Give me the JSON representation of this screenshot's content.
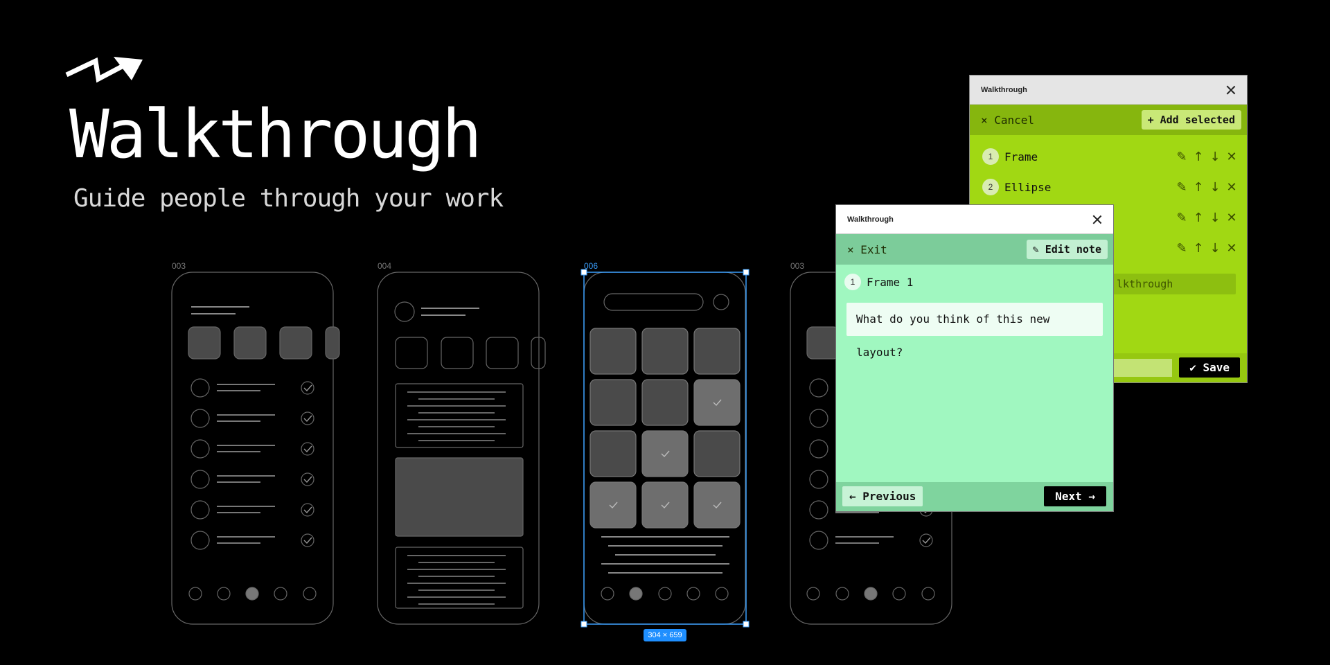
{
  "hero": {
    "title": "Walkthrough",
    "subtitle": "Guide people through your work"
  },
  "frames": [
    {
      "label": "003",
      "selected": false
    },
    {
      "label": "004",
      "selected": false
    },
    {
      "label": "006",
      "selected": true
    },
    {
      "label": "003",
      "selected": false
    }
  ],
  "selection_size": "304 × 659",
  "back_panel": {
    "title": "Walkthrough",
    "cancel_label": "× Cancel",
    "add_selected_label": "+ Add selected",
    "items": [
      {
        "num": "1",
        "label": "Frame"
      },
      {
        "num": "2",
        "label": "Ellipse"
      },
      {
        "num": "",
        "label": ""
      },
      {
        "num": "",
        "label": ""
      }
    ],
    "name_field_value": "lkthrough",
    "save_label": "✔ Save",
    "item_icons": [
      "pencil-icon",
      "arrow-up-icon",
      "arrow-down-icon",
      "close-icon"
    ]
  },
  "front_panel": {
    "title": "Walkthrough",
    "exit_label": "× Exit",
    "edit_note_label": "✎ Edit note",
    "step_num": "1",
    "step_label": "Frame 1",
    "note_text": "What do you think of this new layout?",
    "previous_label": "← Previous",
    "next_label": "Next →"
  },
  "colors": {
    "background": "#000000",
    "accent_lime": "#a1d813",
    "accent_mint": "#a0f7c0",
    "selection_blue": "#1f8fff"
  }
}
